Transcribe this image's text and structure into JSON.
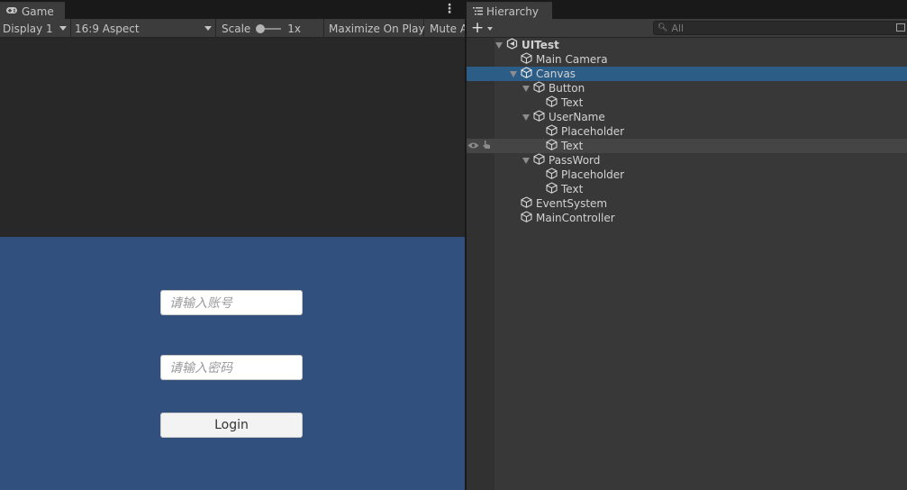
{
  "game": {
    "tab_label": "Game",
    "toolbar": {
      "display_label": "Display 1",
      "aspect_label": "16:9 Aspect",
      "scale_label": "Scale",
      "scale_value": "1x",
      "maximize_label": "Maximize On Play",
      "mute_label": "Mute A"
    },
    "canvas": {
      "username_placeholder": "请输入账号",
      "password_placeholder": "请输入密码",
      "login_label": "Login",
      "background_color": "#31507e"
    }
  },
  "hierarchy": {
    "tab_label": "Hierarchy",
    "search_placeholder": "All",
    "items": [
      {
        "label": "UITest",
        "type": "scene"
      },
      {
        "label": "Main Camera",
        "type": "gameobject"
      },
      {
        "label": "Canvas",
        "type": "gameobject",
        "selected": true
      },
      {
        "label": "Button",
        "type": "gameobject"
      },
      {
        "label": "Text",
        "type": "gameobject"
      },
      {
        "label": "UserName",
        "type": "gameobject"
      },
      {
        "label": "Placeholder",
        "type": "gameobject"
      },
      {
        "label": "Text",
        "type": "gameobject",
        "hovered": true
      },
      {
        "label": "PassWord",
        "type": "gameobject"
      },
      {
        "label": "Placeholder",
        "type": "gameobject"
      },
      {
        "label": "Text",
        "type": "gameobject"
      },
      {
        "label": "EventSystem",
        "type": "gameobject"
      },
      {
        "label": "MainController",
        "type": "gameobject"
      }
    ]
  },
  "colors": {
    "selection": "#2c5d87",
    "panel": "#383838",
    "toolbar": "#3c3c3c"
  }
}
